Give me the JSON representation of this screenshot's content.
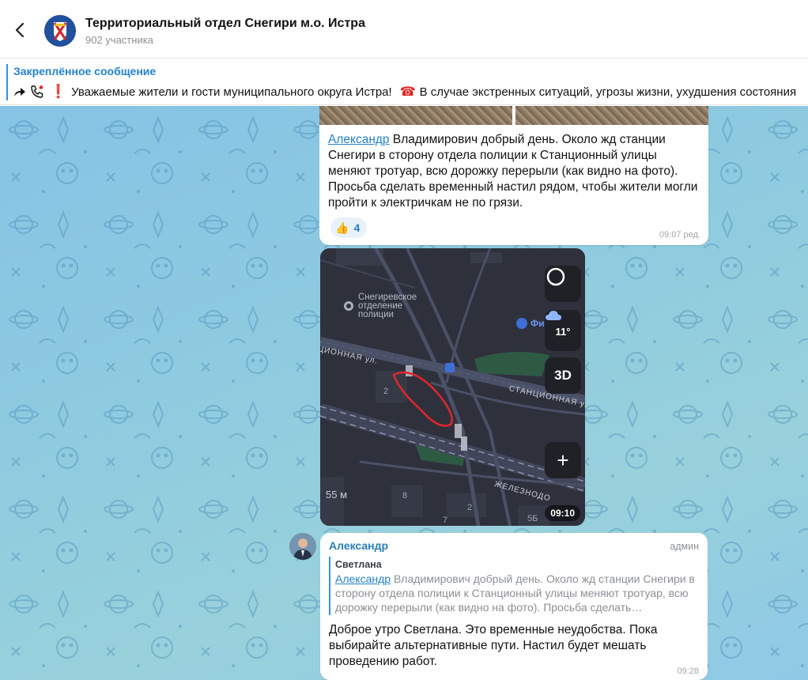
{
  "header": {
    "title": "Территориальный отдел Снегири м.о. Истра",
    "subtitle": "902 участника"
  },
  "pinned": {
    "title": "Закреплённое сообщение",
    "text_1": "Уважаемые жители и гости муниципального округа Истра!",
    "text_2": "В случае экстренных ситуаций, угрозы жизни, ухудшения состояния"
  },
  "messages": [
    {
      "mention": "Александр",
      "text": " Владимирович добрый день. Около жд станции Снегири в сторону отдела полиции к Станционный улицы меняют тротуар, всю дорожку перерыли (как видно на фото). Просьба сделать временный настил рядом, чтобы жители могли пройти к электричкам не по грязи.",
      "reaction_emoji": "👍",
      "reaction_count": "4",
      "time": "09:07 ред."
    },
    {
      "type": "map-screenshot",
      "labels": {
        "police": "Снегиревское\nотделение\nполиции",
        "street_1": "ЦИОННАЯ ул.",
        "street_2": "СТАНЦИОННАЯ ул.",
        "street_3": "ЖЕЛЕЗНОДО",
        "poi": "Фи",
        "temp": "11°",
        "btn_3d": "3D",
        "plus": "+",
        "scale": "55 м",
        "house_1": "2",
        "house_2": "8",
        "house_3": "2",
        "house_4": "7",
        "house_5": "5Б"
      },
      "time": "09:10"
    },
    {
      "author": "Александр",
      "role": "админ",
      "quote_author": "Светлана",
      "quote_mention": "Александр",
      "quote_text": " Владимирович добрый день. Около жд станции Снегири в сторону отдела полиции к Станционный улицы меняют тротуар, всю дорожку перерыли (как видно на фото). Просьба сделать…",
      "text": "Доброе утро Светлана. Это временные неудобства. Пока выбирайте альтернативные пути. Настил будет мешать проведению работ.",
      "time": "09:28"
    }
  ],
  "colors": {
    "accent": "#2481cc",
    "chat_bg": "#8ecbe0",
    "red_mark": "#e0262b"
  }
}
